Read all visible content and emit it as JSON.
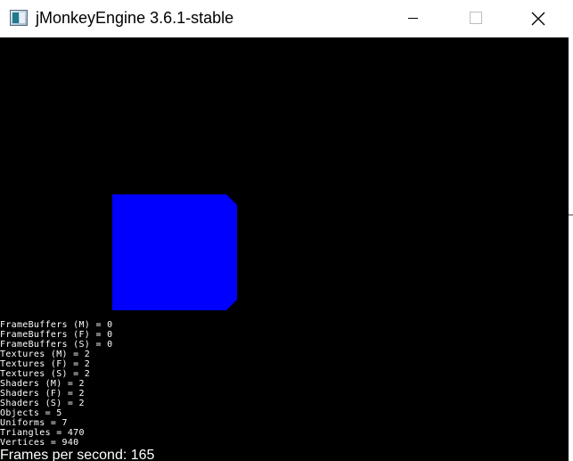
{
  "window": {
    "title": "jMonkeyEngine 3.6.1-stable",
    "icon": "jmonkeyengine-app-icon",
    "controls": [
      "minimize-icon",
      "maximize-icon",
      "close-icon"
    ]
  },
  "scene": {
    "background_color": "#000000",
    "object": "blue-box",
    "object_color": "#0000ff"
  },
  "stats": [
    "FrameBuffers (M) = 0",
    "FrameBuffers (F) = 0",
    "FrameBuffers (S) = 0",
    "Textures (M) = 2",
    "Textures (F) = 2",
    "Textures (S) = 2",
    "Shaders (M) = 2",
    "Shaders (F) = 2",
    "Shaders (S) = 2",
    "Objects = 5",
    "Uniforms = 7",
    "Triangles = 470",
    "Vertices = 940"
  ],
  "fps": "Frames per second: 165"
}
